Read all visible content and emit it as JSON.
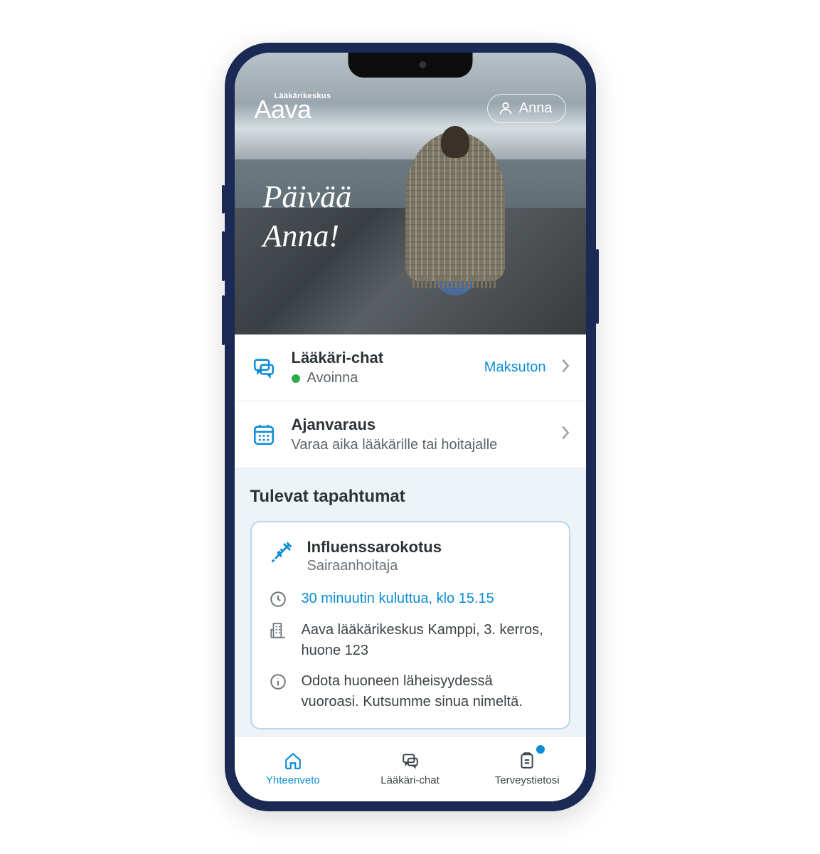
{
  "brand": {
    "tagline": "Lääkärikeskus",
    "name": "Aava"
  },
  "user": {
    "name": "Anna"
  },
  "greeting": {
    "line1": "Päivää",
    "line2": "Anna!"
  },
  "actions": {
    "chat": {
      "title": "Lääkäri-chat",
      "status_label": "Avoinna",
      "status_open": true,
      "badge": "Maksuton"
    },
    "booking": {
      "title": "Ajanvaraus",
      "subtitle": "Varaa aika lääkärille tai hoitajalle"
    }
  },
  "events": {
    "section_title": "Tulevat tapahtumat",
    "items": [
      {
        "title": "Influenssarokotus",
        "role": "Sairaanhoitaja",
        "time": "30 minuutin kuluttua, klo 15.15",
        "location": "Aava lääkärikeskus Kamppi, 3. kerros, huone 123",
        "info": "Odota huoneen läheisyydessä vuoroasi. Kutsumme sinua nimeltä."
      }
    ]
  },
  "tabs": {
    "summary": "Yhteenveto",
    "chat": "Lääkäri-chat",
    "health": "Terveystietosi"
  }
}
